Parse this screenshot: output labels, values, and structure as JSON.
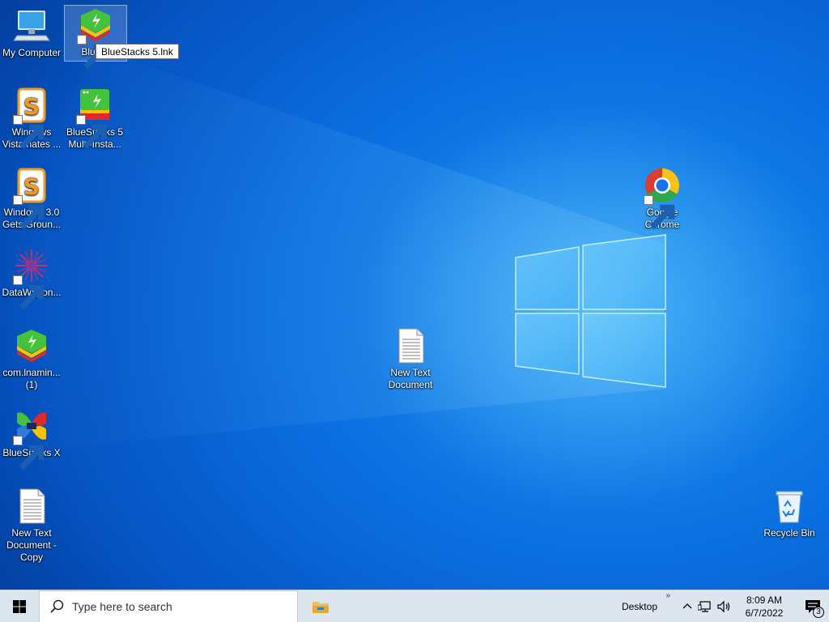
{
  "desktop": {
    "icons": [
      {
        "label": "My Computer",
        "icon": "computer-icon"
      },
      {
        "label": "BlueSt",
        "icon": "bluestacks-icon"
      },
      {
        "label": "Windows\nVista hates ...",
        "icon": "s-doc-icon"
      },
      {
        "label": "BlueStacks 5\nMulti-Insta...",
        "icon": "bluestacks-multi-icon"
      },
      {
        "label": "Windows 3.0\nGets Groun...",
        "icon": "s-doc-icon"
      },
      {
        "label": "DataWagon...",
        "icon": "datawagon-icon"
      },
      {
        "label": "com.lnamin...\n(1)",
        "icon": "bluestacks-icon"
      },
      {
        "label": "BlueStacks X",
        "icon": "bluestacks-x-icon"
      },
      {
        "label": "New Text\nDocument -\nCopy",
        "icon": "text-document-icon"
      },
      {
        "label": "New Text\nDocument",
        "icon": "text-document-icon"
      },
      {
        "label": "Google\nChrome",
        "icon": "chrome-icon"
      },
      {
        "label": "Recycle Bin",
        "icon": "recycle-bin-icon"
      }
    ],
    "tooltip": "BlueStacks 5.lnk"
  },
  "taskbar": {
    "search_placeholder": "Type here to search",
    "desktop_label": "Desktop",
    "toolbar_chevron": "»",
    "time": "8:09 AM",
    "date": "6/7/2022",
    "notification_count": "3"
  },
  "colors": {
    "taskbar_bg": "#dde6ef",
    "wallpaper_blue": "#0b6fe0",
    "windows_accent": "#0078d7"
  }
}
